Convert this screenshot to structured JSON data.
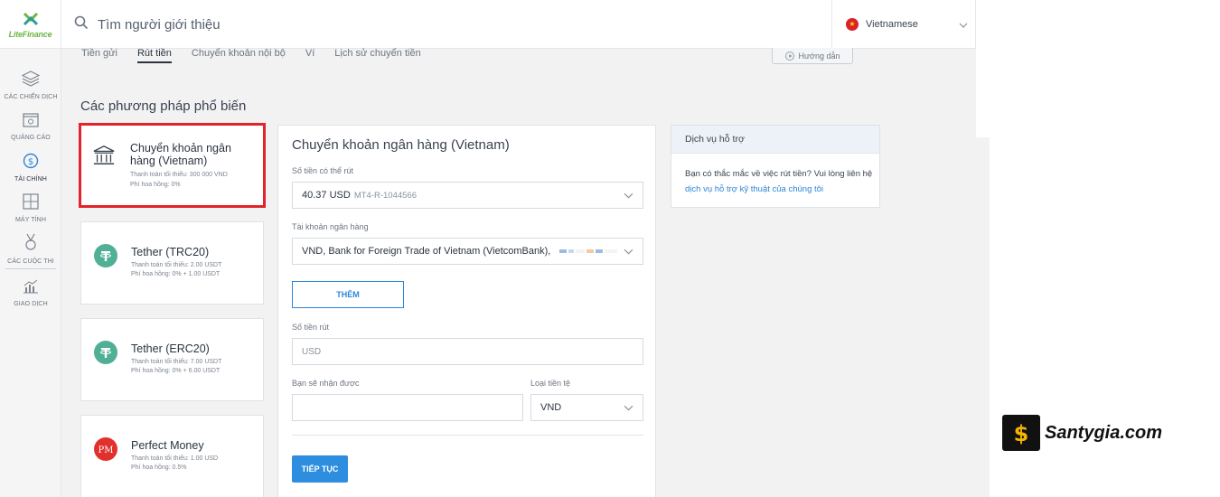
{
  "header": {
    "logo_text": "LiteFinance",
    "search_placeholder": "Tìm người giới thiệu",
    "language": "Vietnamese"
  },
  "sidebar": {
    "items": [
      {
        "label": "CÁC CHIẾN DỊCH",
        "icon": "layers-icon"
      },
      {
        "label": "QUẢNG CÁO",
        "icon": "banner-icon"
      },
      {
        "label": "TÀI CHÍNH",
        "icon": "dollar-icon",
        "active": true
      },
      {
        "label": "MÁY TÍNH",
        "icon": "calculator-icon"
      },
      {
        "label": "CÁC CUỘC THI",
        "icon": "medal-icon"
      },
      {
        "label": "GIAO DỊCH",
        "icon": "chart-icon"
      }
    ]
  },
  "tabs": [
    "Tiền gửi",
    "Rút tiền",
    "Chuyển khoản nội bộ",
    "Ví",
    "Lịch sử chuyển tiền"
  ],
  "active_tab": "Rút tiền",
  "guide_label": "Hướng dẫn",
  "section_title": "Các phương pháp phổ biến",
  "methods": [
    {
      "name": "Chuyển khoản ngân hàng (Vietnam)",
      "min": "Thanh toán tối thiểu: 300 000 VND",
      "fee": "Phí hoa hồng: 0%",
      "icon": "bank-icon"
    },
    {
      "name": "Tether (TRC20)",
      "min": "Thanh toán tối thiểu: 2.00 USDT",
      "fee": "Phí hoa hồng: 0% + 1.00 USDT",
      "icon": "tether-icon"
    },
    {
      "name": "Tether (ERC20)",
      "min": "Thanh toán tối thiểu: 7.00 USDT",
      "fee": "Phí hoa hồng: 0% + 6.00 USDT",
      "icon": "tether-icon"
    },
    {
      "name": "Perfect Money",
      "min": "Thanh toán tối thiểu: 1.00 USD",
      "fee": "Phí hoa hồng: 0.5%",
      "icon": "perfect-money-icon"
    }
  ],
  "form": {
    "title": "Chuyển khoản ngân hàng (Vietnam)",
    "available_label": "Số tiền có thể rút",
    "available_amount": "40.37 USD",
    "available_account": "MT4-R-1044566",
    "bank_account_label": "Tài khoản ngân hàng",
    "bank_account_value": "VND, Bank for Foreign Trade of Vietnam (VietcomBank),",
    "add_button": "THÊM",
    "withdraw_label": "Số tiền rút",
    "withdraw_placeholder": "USD",
    "receive_label": "Bạn sẽ nhận được",
    "receive_value": "",
    "currency_label": "Loại tiền tệ",
    "currency_value": "VND",
    "continue_button": "TIẾP TỤC"
  },
  "support": {
    "title": "Dịch vụ hỗ trợ",
    "text": "Bạn có thắc mắc về việc rút tiền? Vui lòng liên hệ",
    "link": "dịch vụ hỗ trợ kỹ thuật của chúng tôi"
  },
  "watermark": "Santygia.com",
  "colors": {
    "accent_blue": "#2d8ee0",
    "selected_border": "#e2232a",
    "tether_green": "#50af95",
    "pm_red": "#e2312d",
    "brand_green": "#6cb544"
  }
}
